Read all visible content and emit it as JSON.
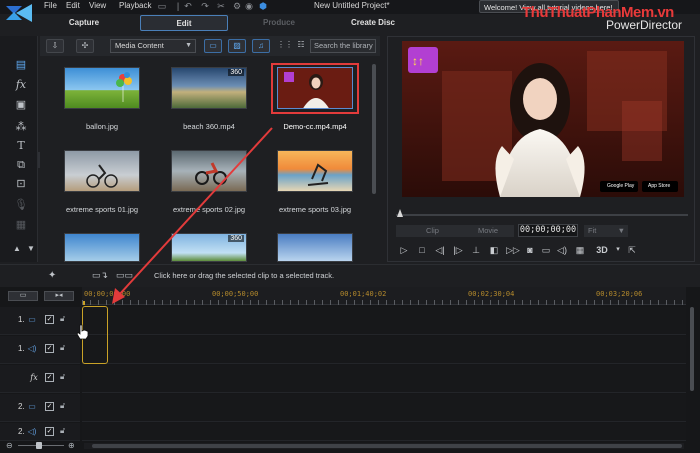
{
  "titlebar": {
    "menu": [
      "File",
      "Edit",
      "View",
      "Playback"
    ],
    "title": "New Untitled Project*",
    "welcome": "Welcome! View all tutorial videos here!",
    "watermark": "ThuThuatPhanMem.vn",
    "brand": "PowerDirector"
  },
  "tabs": [
    {
      "label": "Capture",
      "state": "normal"
    },
    {
      "label": "Edit",
      "state": "active"
    },
    {
      "label": "Produce",
      "state": "disabled"
    },
    {
      "label": "Create Disc",
      "state": "normal"
    }
  ],
  "library": {
    "media_select": "Media Content",
    "search_placeholder": "Search the library",
    "items": [
      {
        "label": "ballon.jpg",
        "badge": ""
      },
      {
        "label": "beach 360.mp4",
        "badge": "360"
      },
      {
        "label": "Demo-cc.mp4.mp4",
        "badge": ""
      },
      {
        "label": "extreme sports 01.jpg",
        "badge": ""
      },
      {
        "label": "extreme sports 02.jpg",
        "badge": ""
      },
      {
        "label": "extreme sports 03.jpg",
        "badge": ""
      },
      {
        "label": "",
        "badge": ""
      },
      {
        "label": "",
        "badge": "360"
      },
      {
        "label": "",
        "badge": ""
      }
    ]
  },
  "preview": {
    "clip_label": "Clip",
    "movie_label": "Movie",
    "timecode": "00;00;00;00",
    "fit_label": "Fit",
    "mode_3d": "3D",
    "store_badges": [
      "Google Play",
      "App Store"
    ]
  },
  "timeline": {
    "hint": "Click here or drag the selected clip to a selected track.",
    "ruler_labels": [
      "00;00;00;00",
      "00;00;50;00",
      "00;01;40;02",
      "00;02;30;04",
      "00;03;20;06"
    ],
    "tracks": [
      {
        "num": "1.",
        "type": "video",
        "checked": "✓"
      },
      {
        "num": "1.",
        "type": "audio",
        "checked": "✓"
      },
      {
        "num": "",
        "type": "fx",
        "checked": "✓"
      },
      {
        "num": "2.",
        "type": "video",
        "checked": "✓"
      },
      {
        "num": "2.",
        "type": "audio",
        "checked": "✓"
      }
    ]
  },
  "colors": {
    "accent_blue": "#4a7fb8",
    "highlight_red": "#e23b3b",
    "playhead_gold": "#c9a227",
    "ruler_text": "#b48a2c"
  }
}
